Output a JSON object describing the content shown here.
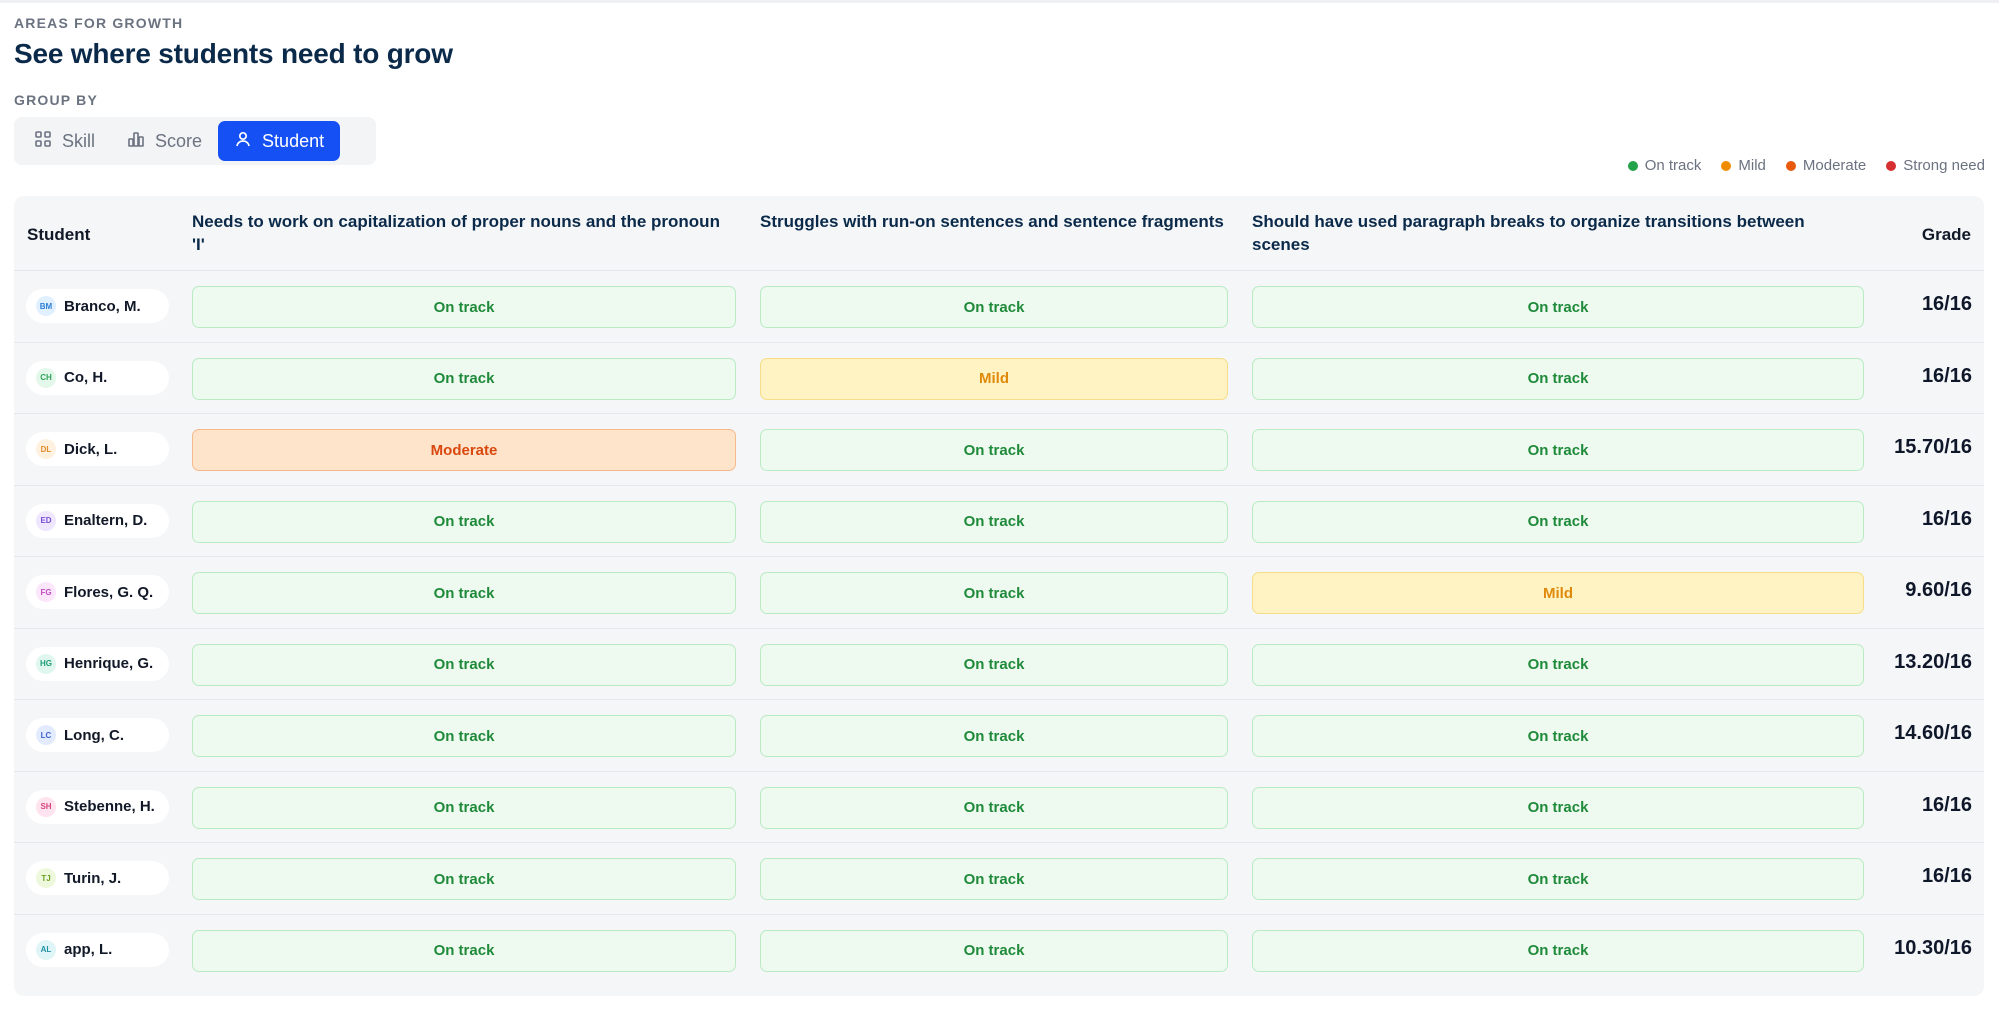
{
  "header": {
    "eyebrow": "AREAS FOR GROWTH",
    "title": "See where students need to grow",
    "group_by_label": "GROUP BY"
  },
  "group_by": {
    "options": [
      {
        "label": "Skill",
        "icon": "grid-icon",
        "active": false
      },
      {
        "label": "Score",
        "icon": "bar-chart-icon",
        "active": false
      },
      {
        "label": "Student",
        "icon": "user-icon",
        "active": true
      }
    ]
  },
  "legend": [
    {
      "label": "On track",
      "color": "#22a34a"
    },
    {
      "label": "Mild",
      "color": "#f08c00"
    },
    {
      "label": "Moderate",
      "color": "#e8590c"
    },
    {
      "label": "Strong need",
      "color": "#d63031"
    }
  ],
  "table": {
    "columns": {
      "student": "Student",
      "skill1": "Needs to work on capitalization of proper nouns and the pronoun 'I'",
      "skill2": "Struggles with run-on sentences and sentence fragments",
      "skill3": "Should have used paragraph breaks to organize transitions between scenes",
      "grade": "Grade"
    },
    "rows": [
      {
        "initials": "BM",
        "name": "Branco, M.",
        "avatar_bg": "#e0f0ff",
        "avatar_fg": "#2f7fd6",
        "skills": [
          "On track",
          "On track",
          "On track"
        ],
        "grade": "16/16"
      },
      {
        "initials": "CH",
        "name": "Co, H.",
        "avatar_bg": "#e3f8ea",
        "avatar_fg": "#2fa35a",
        "skills": [
          "On track",
          "Mild",
          "On track"
        ],
        "grade": "16/16"
      },
      {
        "initials": "DL",
        "name": "Dick, L.",
        "avatar_bg": "#fff1e0",
        "avatar_fg": "#e08a2a",
        "skills": [
          "Moderate",
          "On track",
          "On track"
        ],
        "grade": "15.70/16"
      },
      {
        "initials": "ED",
        "name": "Enaltern, D.",
        "avatar_bg": "#efe6ff",
        "avatar_fg": "#7c4dd6",
        "skills": [
          "On track",
          "On track",
          "On track"
        ],
        "grade": "16/16"
      },
      {
        "initials": "FG",
        "name": "Flores, G. Q.",
        "avatar_bg": "#fbe6fb",
        "avatar_fg": "#c04fc0",
        "skills": [
          "On track",
          "On track",
          "Mild"
        ],
        "grade": "9.60/16"
      },
      {
        "initials": "HG",
        "name": "Henrique, G.",
        "avatar_bg": "#dff7ef",
        "avatar_fg": "#1f9d77",
        "skills": [
          "On track",
          "On track",
          "On track"
        ],
        "grade": "13.20/16"
      },
      {
        "initials": "LC",
        "name": "Long, C.",
        "avatar_bg": "#e3ebff",
        "avatar_fg": "#3d62d6",
        "skills": [
          "On track",
          "On track",
          "On track"
        ],
        "grade": "14.60/16"
      },
      {
        "initials": "SH",
        "name": "Stebenne, H.",
        "avatar_bg": "#ffe3ee",
        "avatar_fg": "#d6477f",
        "skills": [
          "On track",
          "On track",
          "On track"
        ],
        "grade": "16/16"
      },
      {
        "initials": "TJ",
        "name": "Turin, J.",
        "avatar_bg": "#eef8dc",
        "avatar_fg": "#6aa224",
        "skills": [
          "On track",
          "On track",
          "On track"
        ],
        "grade": "16/16"
      },
      {
        "initials": "AL",
        "name": "app, L.",
        "avatar_bg": "#dff5f7",
        "avatar_fg": "#1f93a3",
        "skills": [
          "On track",
          "On track",
          "On track"
        ],
        "grade": "10.30/16"
      }
    ]
  }
}
